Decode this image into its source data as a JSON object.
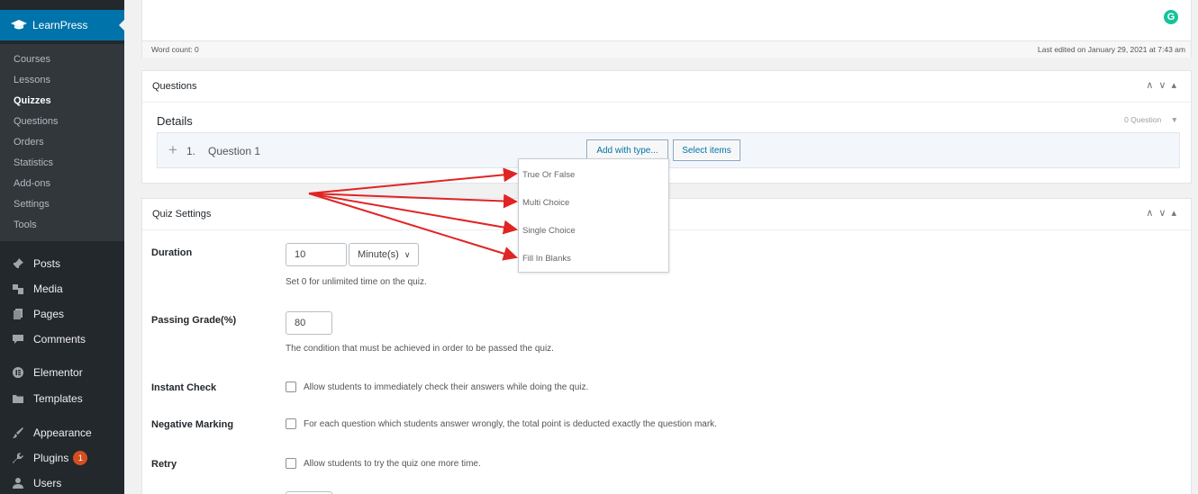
{
  "sidebar": {
    "plugin_title": "LearnPress",
    "submenu": [
      "Courses",
      "Lessons",
      "Quizzes",
      "Questions",
      "Orders",
      "Statistics",
      "Add-ons",
      "Settings",
      "Tools"
    ],
    "current_submenu": "Quizzes",
    "menu": [
      {
        "label": "Posts",
        "icon": "pin-icon"
      },
      {
        "label": "Media",
        "icon": "media-icon"
      },
      {
        "label": "Pages",
        "icon": "pages-icon"
      },
      {
        "label": "Comments",
        "icon": "comments-icon"
      },
      {
        "label": "Elementor",
        "icon": "elementor-icon"
      },
      {
        "label": "Templates",
        "icon": "folder-icon"
      },
      {
        "label": "Appearance",
        "icon": "brush-icon"
      },
      {
        "label": "Plugins",
        "icon": "plugin-icon",
        "badge": "1"
      },
      {
        "label": "Users",
        "icon": "user-icon"
      }
    ]
  },
  "editor": {
    "word_count": "Word count: 0",
    "last_edited": "Last edited on January 29, 2021 at 7:43 am",
    "grammarly_letter": "G"
  },
  "questions_panel": {
    "title": "Questions",
    "details_title": "Details",
    "question_count": "0 Question",
    "question": {
      "number": "1.",
      "title": "Question 1"
    },
    "add_with_type_label": "Add with type...",
    "select_items_label": "Select items",
    "type_options": [
      "True Or False",
      "Multi Choice",
      "Single Choice",
      "Fill In Blanks"
    ]
  },
  "quiz_settings": {
    "title": "Quiz Settings",
    "duration": {
      "label": "Duration",
      "value": "10",
      "unit": "Minute(s)",
      "desc": "Set 0 for unlimited time on the quiz."
    },
    "passing_grade": {
      "label": "Passing Grade(%)",
      "value": "80",
      "desc": "The condition that must be achieved in order to be passed the quiz."
    },
    "instant_check": {
      "label": "Instant Check",
      "desc": "Allow students to immediately check their answers while doing the quiz."
    },
    "negative_marking": {
      "label": "Negative Marking",
      "desc": "For each question which students answer wrongly, the total point is deducted exactly the question mark."
    },
    "retry": {
      "label": "Retry",
      "desc": "Allow students to try the quiz one more time."
    }
  },
  "colors": {
    "accent": "#0073aa",
    "sidebar": "#23282d",
    "arrow": "#e02424",
    "grammarly": "#15c39a"
  }
}
